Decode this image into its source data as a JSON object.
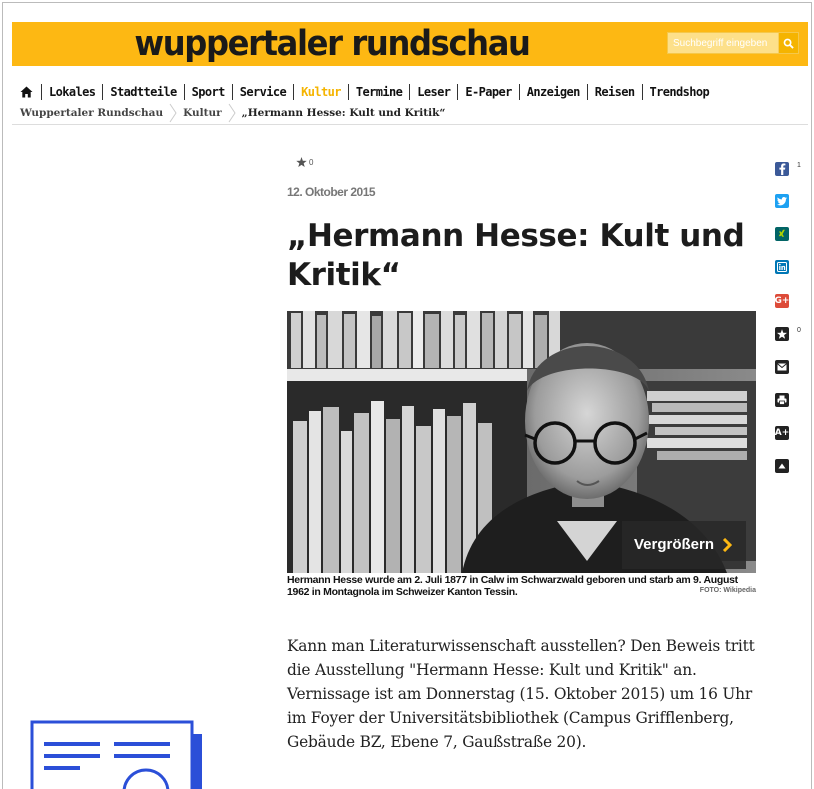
{
  "header": {
    "logo": "wuppertaler rundschau",
    "search_placeholder": "Suchbegriff eingeben"
  },
  "nav": {
    "items": [
      "Lokales",
      "Stadtteile",
      "Sport",
      "Service",
      "Kultur",
      "Termine",
      "Leser",
      "E-Paper",
      "Anzeigen",
      "Reisen",
      "Trendshop"
    ],
    "active": "Kultur"
  },
  "breadcrumb": [
    "Wuppertaler Rundschau",
    "Kultur",
    "„Hermann Hesse: Kult und Kritik“"
  ],
  "article": {
    "rating_count": "0",
    "date": "12. Oktober 2015",
    "title": "„Hermann Hesse: Kult und Kritik“",
    "enlarge_label": "Vergrößern",
    "caption": "Hermann Hesse wurde am 2. Juli 1877 in Calw im Schwarzwald geboren und starb am 9. August 1962 in Montagnola im Schweizer Kanton Tessin.",
    "credit": "FOTO: Wikipedia",
    "body": "Kann man Literaturwissenschaft ausstellen? Den Beweis tritt die Ausstellung \"Hermann Hesse: Kult und Kritik\" an. Vernissage ist am Donnerstag (15. Oktober 2015) um 16 Uhr im Foyer der Universitätsbibliothek (Campus Grifflenberg, Gebäude BZ, Ebene 7, Gaußstraße 20)."
  },
  "social": {
    "facebook_count": "1",
    "favorite_count": "0",
    "googleplus_label": "G+",
    "font_size_label": "A+"
  },
  "colors": {
    "brand": "#fdb813",
    "facebook": "#3b5998",
    "twitter": "#1da1f2",
    "xing": "#026466",
    "linkedin": "#0077b5",
    "googleplus": "#dd4b39",
    "promo": "#2b4fd8"
  },
  "icons": [
    "search-icon",
    "home-icon",
    "chevron-right-icon",
    "star-icon",
    "facebook-icon",
    "twitter-icon",
    "xing-icon",
    "linkedin-icon",
    "googleplus-icon",
    "favorite-icon",
    "email-icon",
    "print-icon",
    "font-size-icon",
    "scroll-top-icon",
    "newspaper-icon"
  ]
}
